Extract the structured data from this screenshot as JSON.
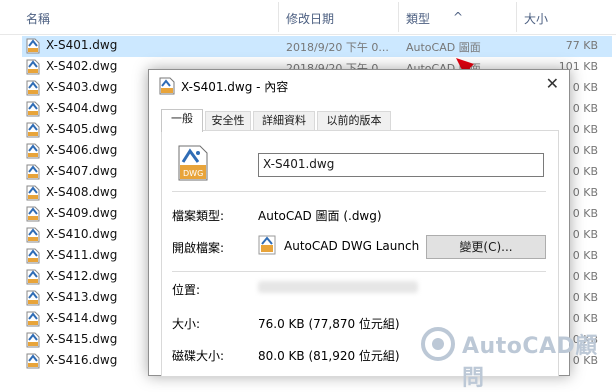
{
  "explorer": {
    "columns": {
      "name": "名稱",
      "date": "修改日期",
      "type": "類型",
      "size": "大小"
    },
    "files": [
      {
        "name": "X-S401.dwg",
        "date": "2018/9/20 下午 0...",
        "type": "AutoCAD 圖面",
        "size": "77 KB"
      },
      {
        "name": "X-S402.dwg",
        "date": "2018/9/20 下午 0...",
        "type": "AutoCAD 圖面",
        "size": "101 KB"
      },
      {
        "name": "X-S403.dwg",
        "size": "0 KB"
      },
      {
        "name": "X-S404.dwg",
        "size": "0 KB"
      },
      {
        "name": "X-S405.dwg",
        "size": "0 KB"
      },
      {
        "name": "X-S406.dwg",
        "size": "0 KB"
      },
      {
        "name": "X-S407.dwg",
        "size": "0 KB"
      },
      {
        "name": "X-S408.dwg",
        "size": "0 KB"
      },
      {
        "name": "X-S409.dwg",
        "size": "0 KB"
      },
      {
        "name": "X-S410.dwg",
        "size": "0 KB"
      },
      {
        "name": "X-S411.dwg",
        "size": "0 KB"
      },
      {
        "name": "X-S412.dwg",
        "size": "0 KB"
      },
      {
        "name": "X-S413.dwg",
        "size": "0 KB"
      },
      {
        "name": "X-S414.dwg",
        "size": "0 KB"
      },
      {
        "name": "X-S415.dwg",
        "size": "0 KB"
      },
      {
        "name": "X-S416.dwg",
        "size": "0 KB"
      }
    ]
  },
  "dialog": {
    "title": "X-S401.dwg - 內容",
    "close": "✕",
    "tabs": [
      "一般",
      "安全性",
      "詳細資料",
      "以前的版本"
    ],
    "filename": "X-S401.dwg",
    "fields": {
      "type_label": "檔案類型:",
      "type_value": "AutoCAD 圖面 (.dwg)",
      "open_label": "開啟檔案:",
      "open_value": "AutoCAD DWG Launch",
      "change_button": "變更(C)...",
      "location_label": "位置:",
      "size_label": "大小:",
      "size_value": "76.0 KB (77,870 位元組)",
      "disk_label": "磁碟大小:",
      "disk_value": "80.0 KB (81,920 位元組)"
    }
  },
  "watermark": "AutoCAD顧問",
  "colors": {
    "accent": "#cce8ff",
    "arrow": "#e3000f",
    "header_text": "#4d6082"
  }
}
